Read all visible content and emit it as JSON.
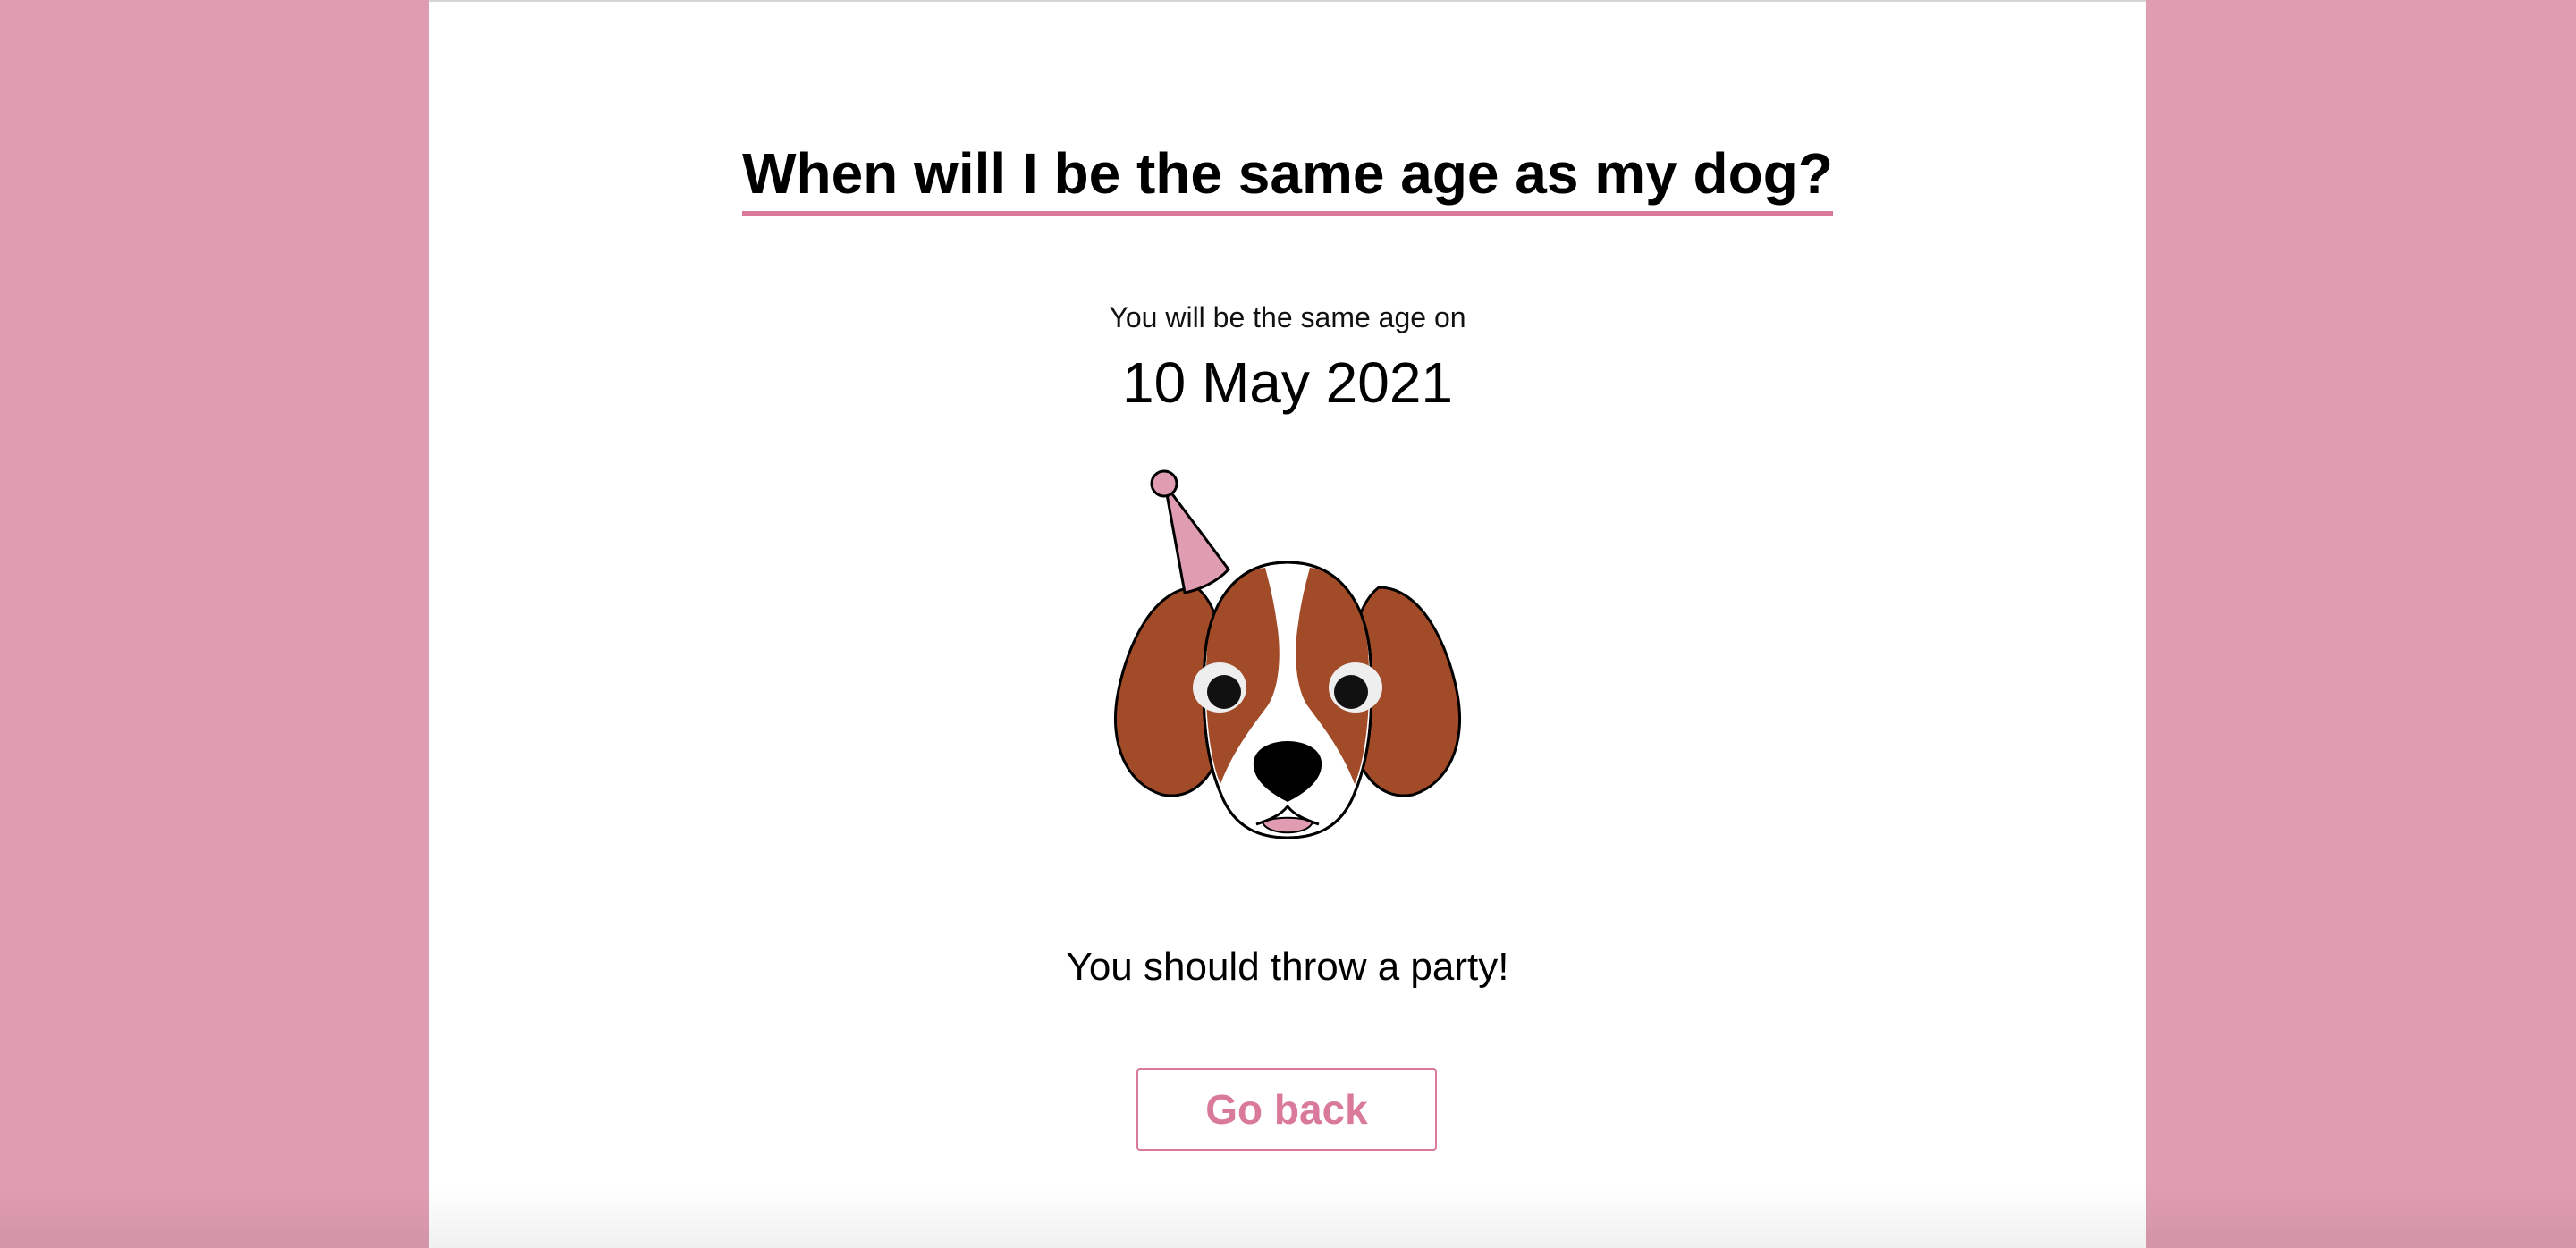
{
  "header": {
    "title": "When will I be the same age as my dog?"
  },
  "result": {
    "intro": "You will be the same age on",
    "date": "10 May 2021",
    "message": "You should throw a party!"
  },
  "actions": {
    "back_label": "Go back"
  },
  "illustration": {
    "name": "party-dog-icon"
  },
  "colors": {
    "accent": "#d97a9c",
    "background": "#e09db1",
    "panel": "#ffffff",
    "dog_fur": "#a24b28",
    "hat": "#e09db1"
  }
}
